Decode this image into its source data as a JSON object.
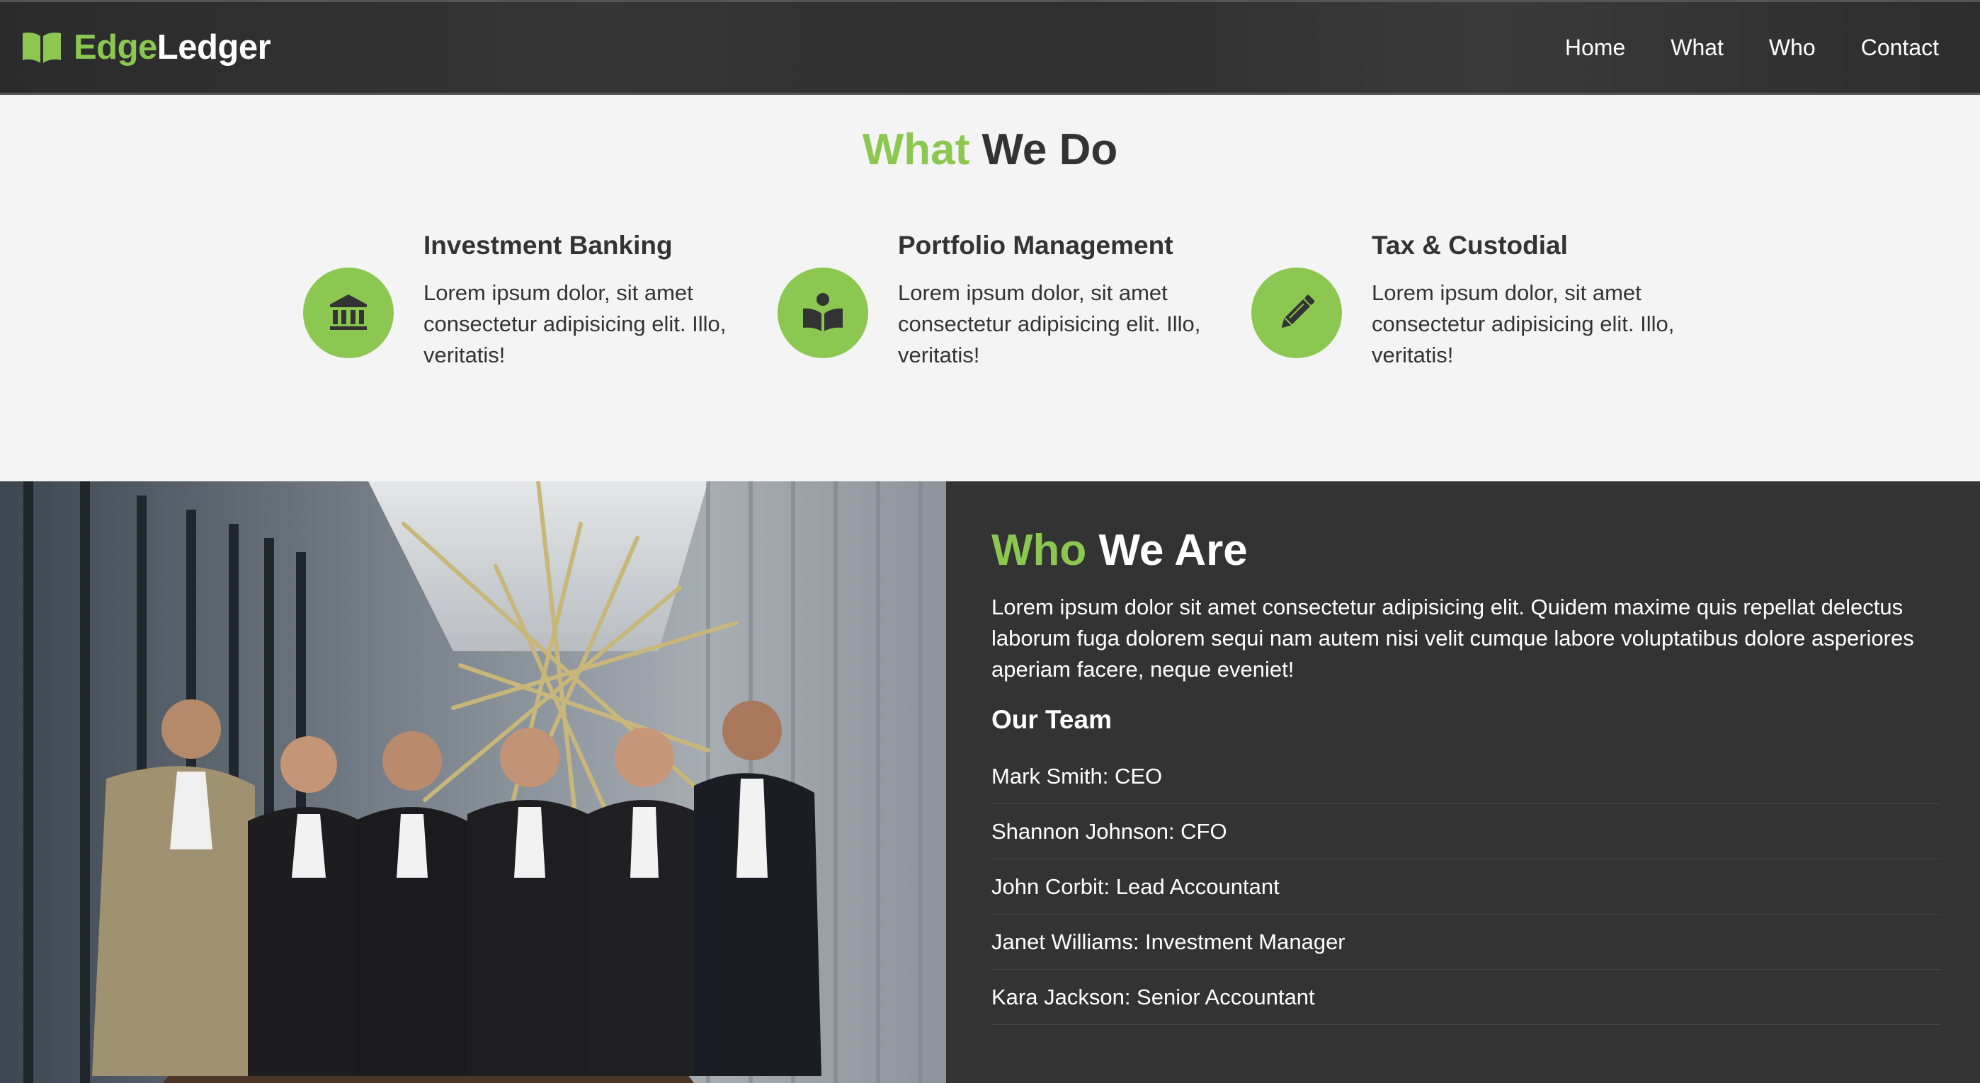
{
  "colors": {
    "accent": "#8bc751",
    "dark_bg": "#333333",
    "light_bg": "#f4f4f4",
    "text_dark": "#333333"
  },
  "navbar": {
    "logo_icon": "book-open-icon",
    "brand_accent": "Edge",
    "brand_main": "Ledger",
    "links": [
      {
        "label": "Home"
      },
      {
        "label": "What"
      },
      {
        "label": "Who"
      },
      {
        "label": "Contact"
      }
    ]
  },
  "what_section": {
    "title_accent": "What",
    "title_rest": "We Do",
    "services": [
      {
        "icon": "bank-icon",
        "title": "Investment Banking",
        "text": "Lorem ipsum dolor, sit amet consectetur adipisicing elit. Illo, veritatis!"
      },
      {
        "icon": "book-reader-icon",
        "title": "Portfolio Management",
        "text": "Lorem ipsum dolor, sit amet consectetur adipisicing elit. Illo, veritatis!"
      },
      {
        "icon": "pencil-icon",
        "title": "Tax & Custodial",
        "text": "Lorem ipsum dolor, sit amet consectetur adipisicing elit. Illo, veritatis!"
      }
    ]
  },
  "who_section": {
    "title_accent": "Who",
    "title_rest": "We Are",
    "text": "Lorem ipsum dolor sit amet consectetur adipisicing elit. Quidem maxime quis repellat delectus laborum fuga dolorem sequi nam autem nisi velit cumque labore voluptatibus dolore asperiores aperiam facere, neque eveniet!",
    "team_heading": "Our Team",
    "team": [
      "Mark Smith: CEO",
      "Shannon Johnson: CFO",
      "John Corbit: Lead Accountant",
      "Janet Williams: Investment Manager",
      "Kara Jackson: Senior Accountant"
    ]
  }
}
